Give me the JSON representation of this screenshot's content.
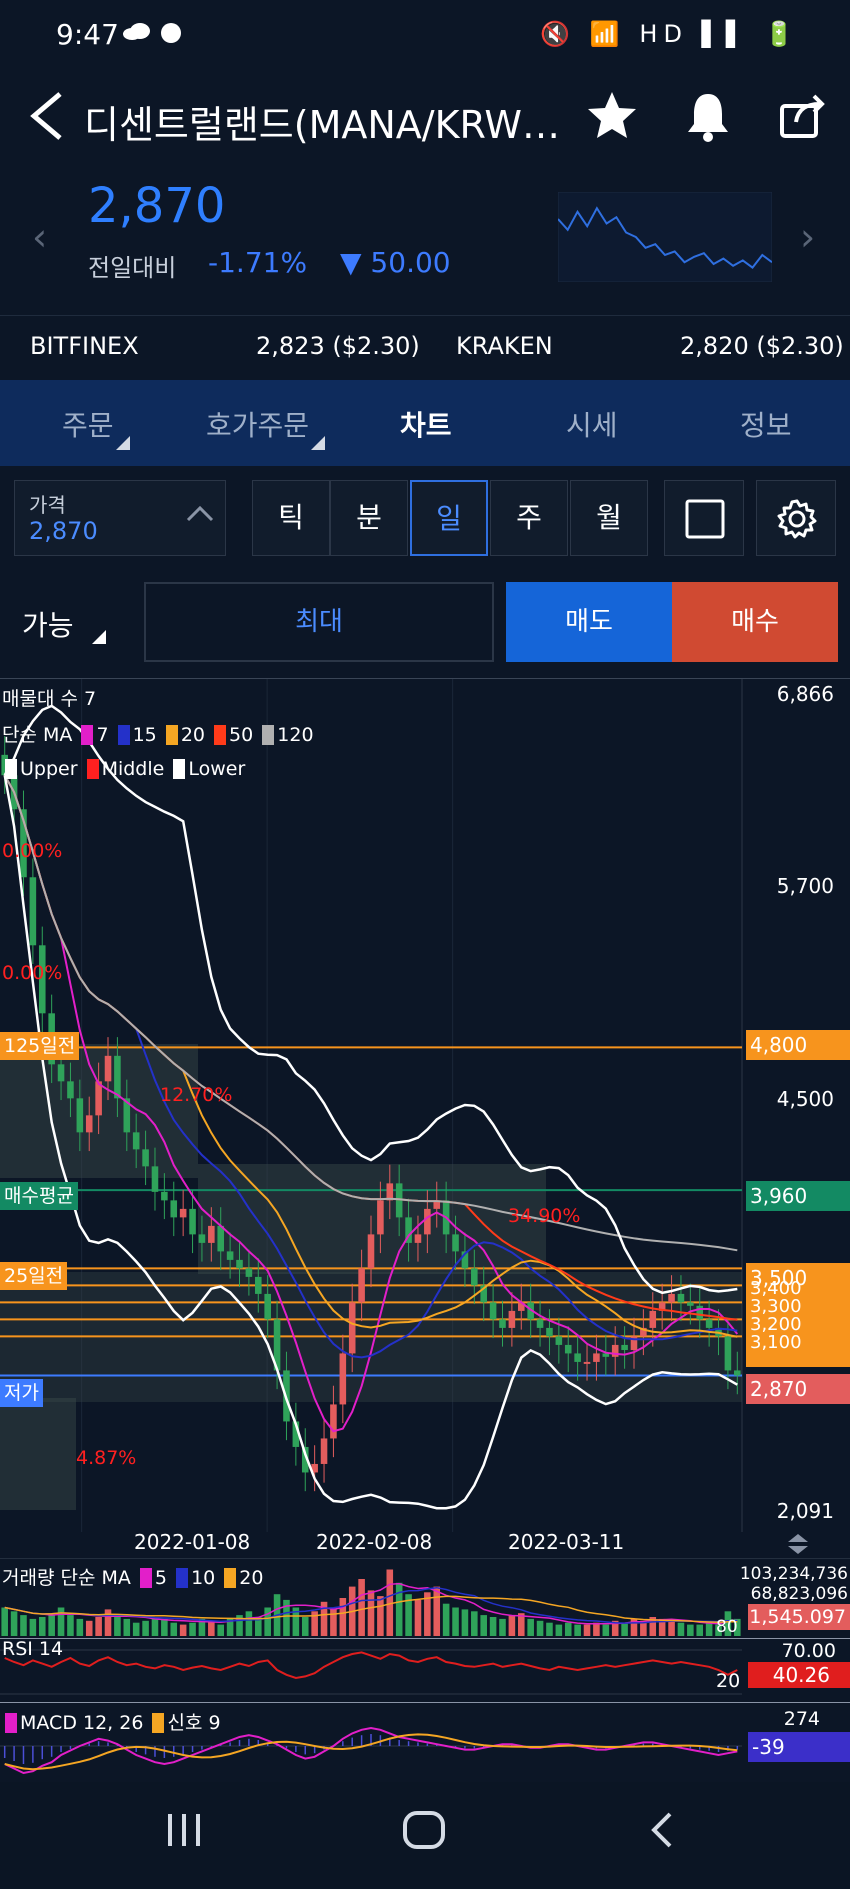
{
  "status": {
    "time": "9:47",
    "icons": "🔇 📶 HD ▌▌ 🔋"
  },
  "header": {
    "title": "디센트럴랜드(MANA/KRW…"
  },
  "price": {
    "current": "2,870",
    "cmp_label": "전일대비",
    "change_pct": "-1.71%",
    "change_abs": "▼ 50.00"
  },
  "sparkline": [
    30,
    42,
    22,
    38,
    18,
    35,
    28,
    45,
    50,
    62,
    58,
    70,
    66,
    78,
    72,
    68,
    80,
    74,
    82,
    76,
    84,
    70,
    78
  ],
  "exchanges": [
    {
      "name": "BITFINEX",
      "value": "2,823 ($2.30)"
    },
    {
      "name": "KRAKEN",
      "value": "2,820 ($2.30)"
    }
  ],
  "tabs": [
    "주문",
    "호가주문",
    "차트",
    "시세",
    "정보"
  ],
  "controls": {
    "price_label": "가격",
    "price_value": "2,870",
    "periods": [
      "틱",
      "분",
      "일",
      "주",
      "월"
    ],
    "active_period": "일"
  },
  "order": {
    "avail": "가능",
    "max": "최대",
    "sell": "매도",
    "buy": "매수"
  },
  "colors": {
    "sell": "#1565d8",
    "buy": "#d04a32",
    "up": "#e35d5d",
    "down": "#2fa35a",
    "orange": "#f7941d",
    "green": "#138a63",
    "blue": "#3d7bff"
  },
  "chart_data": {
    "type": "candlestick",
    "legend": {
      "volume_profile": "매물대 수 7",
      "ma_label": "단순 MA",
      "ma_periods": [
        "7",
        "15",
        "20",
        "50",
        "120"
      ],
      "bb": [
        "Upper",
        "Middle",
        "Lower"
      ]
    },
    "ylim": [
      2091,
      6866
    ],
    "y_ticks": [
      "6,866",
      "5,700",
      "4,500",
      "2,091"
    ],
    "x_ticks": [
      "2022-01-08",
      "2022-02-08",
      "2022-03-11"
    ],
    "levels": [
      {
        "label": "125일전",
        "value": "4,800",
        "color": "#f7941d"
      },
      {
        "label": "매수평균",
        "value": "3,960",
        "color": "#138a63"
      },
      {
        "label": "25일전",
        "value": "3,500",
        "color": "#f7941d"
      },
      {
        "label": "",
        "value": "3,400",
        "color": "#f7941d"
      },
      {
        "label": "",
        "value": "3,300",
        "color": "#f7941d"
      },
      {
        "label": "",
        "value": "3,200",
        "color": "#f7941d"
      },
      {
        "label": "",
        "value": "3,100",
        "color": "#f7941d"
      },
      {
        "label": "저가",
        "value": "2,870",
        "color": "#3d7bff"
      }
    ],
    "annotations": [
      "0.00%",
      "0.00%",
      "12.70%",
      "34.90%",
      "4.87%"
    ],
    "close": [
      6400,
      6200,
      5800,
      5400,
      5000,
      4700,
      4600,
      4500,
      4300,
      4400,
      4600,
      4750,
      4500,
      4300,
      4200,
      4100,
      3950,
      3900,
      3800,
      3850,
      3700,
      3650,
      3750,
      3600,
      3550,
      3500,
      3450,
      3350,
      3200,
      2900,
      2600,
      2450,
      2300,
      2350,
      2500,
      2700,
      3000,
      3300,
      3500,
      3700,
      3900,
      4000,
      3800,
      3650,
      3700,
      3850,
      3900,
      3700,
      3600,
      3500,
      3400,
      3300,
      3200,
      3150,
      3250,
      3300,
      3200,
      3150,
      3100,
      3050,
      3000,
      2950,
      2950,
      3000,
      2980,
      3050,
      3020,
      3100,
      3150,
      3250,
      3300,
      3350,
      3300,
      3280,
      3200,
      3150,
      3100,
      2900,
      2870
    ]
  },
  "volume": {
    "legend": "거래량 단순 MA",
    "periods": [
      "5",
      "10",
      "20"
    ],
    "labels": [
      "103,234,736",
      "68,823,096",
      "1,545.097"
    ],
    "threshold": "80",
    "values": [
      30,
      26,
      22,
      18,
      20,
      24,
      30,
      22,
      18,
      16,
      20,
      28,
      22,
      18,
      14,
      16,
      20,
      18,
      14,
      12,
      14,
      18,
      16,
      12,
      18,
      22,
      26,
      20,
      30,
      44,
      38,
      30,
      20,
      26,
      36,
      28,
      40,
      52,
      60,
      48,
      42,
      70,
      56,
      44,
      38,
      46,
      52,
      34,
      30,
      28,
      26,
      22,
      20,
      18,
      22,
      24,
      18,
      16,
      14,
      12,
      14,
      12,
      12,
      14,
      12,
      16,
      14,
      18,
      16,
      20,
      18,
      16,
      14,
      12,
      12,
      14,
      12,
      26,
      18
    ]
  },
  "rsi": {
    "legend": "RSI 14",
    "labels": [
      "70.00",
      "20",
      "40.26"
    ],
    "values": [
      55,
      50,
      46,
      52,
      48,
      44,
      50,
      55,
      48,
      45,
      52,
      56,
      50,
      46,
      48,
      44,
      42,
      46,
      44,
      40,
      43,
      45,
      42,
      40,
      44,
      48,
      45,
      50,
      52,
      40,
      34,
      30,
      32,
      36,
      44,
      50,
      56,
      60,
      62,
      58,
      54,
      60,
      58,
      52,
      50,
      54,
      56,
      50,
      48,
      45,
      44,
      46,
      48,
      44,
      46,
      48,
      45,
      42,
      40,
      44,
      42,
      40,
      42,
      44,
      46,
      44,
      46,
      48,
      50,
      52,
      50,
      48,
      50,
      48,
      46,
      44,
      40,
      34,
      40
    ]
  },
  "macd": {
    "legend": "MACD 12, 26",
    "signal_label": "신호 9",
    "labels": [
      "274",
      "-39"
    ],
    "values": [
      -20,
      -25,
      -30,
      -28,
      -22,
      -18,
      -10,
      -5,
      0,
      4,
      8,
      6,
      2,
      -4,
      -10,
      -14,
      -18,
      -20,
      -18,
      -14,
      -10,
      -6,
      -2,
      2,
      6,
      10,
      12,
      10,
      6,
      2,
      -4,
      -10,
      -14,
      -12,
      -6,
      0,
      8,
      14,
      18,
      20,
      18,
      14,
      10,
      8,
      6,
      4,
      2,
      0,
      -2,
      -4,
      -4,
      -2,
      0,
      2,
      2,
      0,
      -2,
      -2,
      0,
      2,
      2,
      0,
      -2,
      -4,
      -4,
      -2,
      0,
      2,
      4,
      4,
      2,
      0,
      -2,
      -4,
      -6,
      -8,
      -10,
      -8,
      -6
    ]
  },
  "nav": {
    "recent": "|||",
    "home": "○",
    "back": "<"
  }
}
